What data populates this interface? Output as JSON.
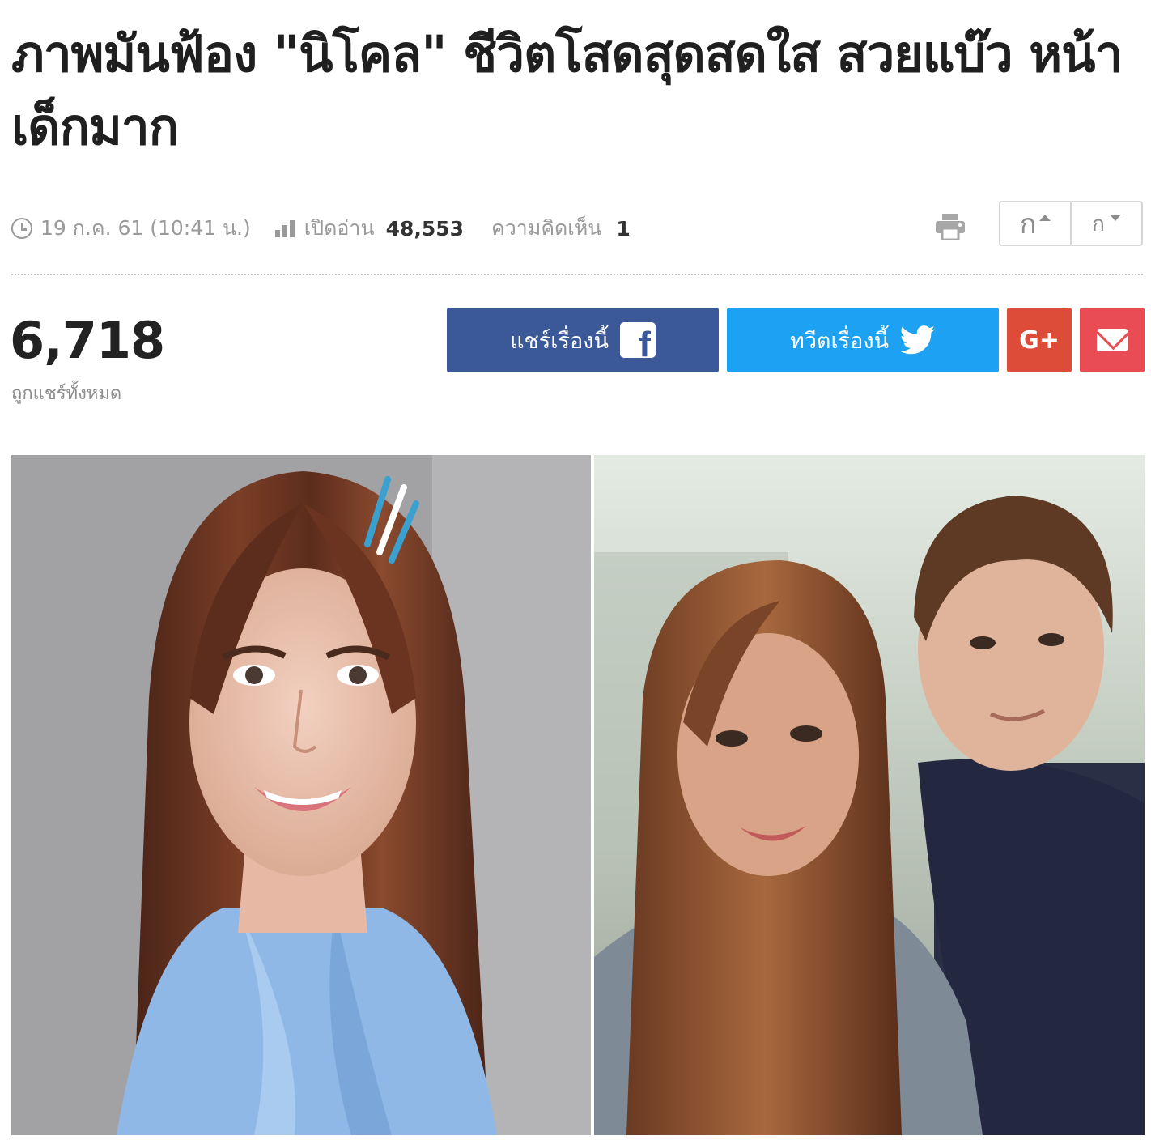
{
  "article": {
    "headline": "ภาพมันฟ้อง \"นิโคล\" ชีวิตโสดสุดสดใส สวยแบ๊ว หน้าเด็กมาก",
    "date": "19 ก.ค. 61 (10:41 น.)",
    "views_label": "เปิดอ่าน",
    "views_count": "48,553",
    "comments_label": "ความคิดเห็น",
    "comments_count": "1"
  },
  "font_controls": {
    "increase_glyph": "ก",
    "decrease_glyph": "ก"
  },
  "share": {
    "total": "6,718",
    "caption": "ถูกแชร์ทั้งหมด",
    "facebook_label": "แชร์เรื่องนี้",
    "twitter_label": "ทวีตเรื่องนี้",
    "google_label": "G+",
    "colors": {
      "facebook": "#3b5998",
      "twitter": "#1da1f2",
      "google": "#dd4b39",
      "email": "#e94d53"
    }
  },
  "icons": {
    "clock": "clock-icon",
    "stats": "bar-chart-icon",
    "print": "printer-icon",
    "facebook": "facebook-icon",
    "twitter": "twitter-bird-icon",
    "email": "envelope-icon"
  }
}
